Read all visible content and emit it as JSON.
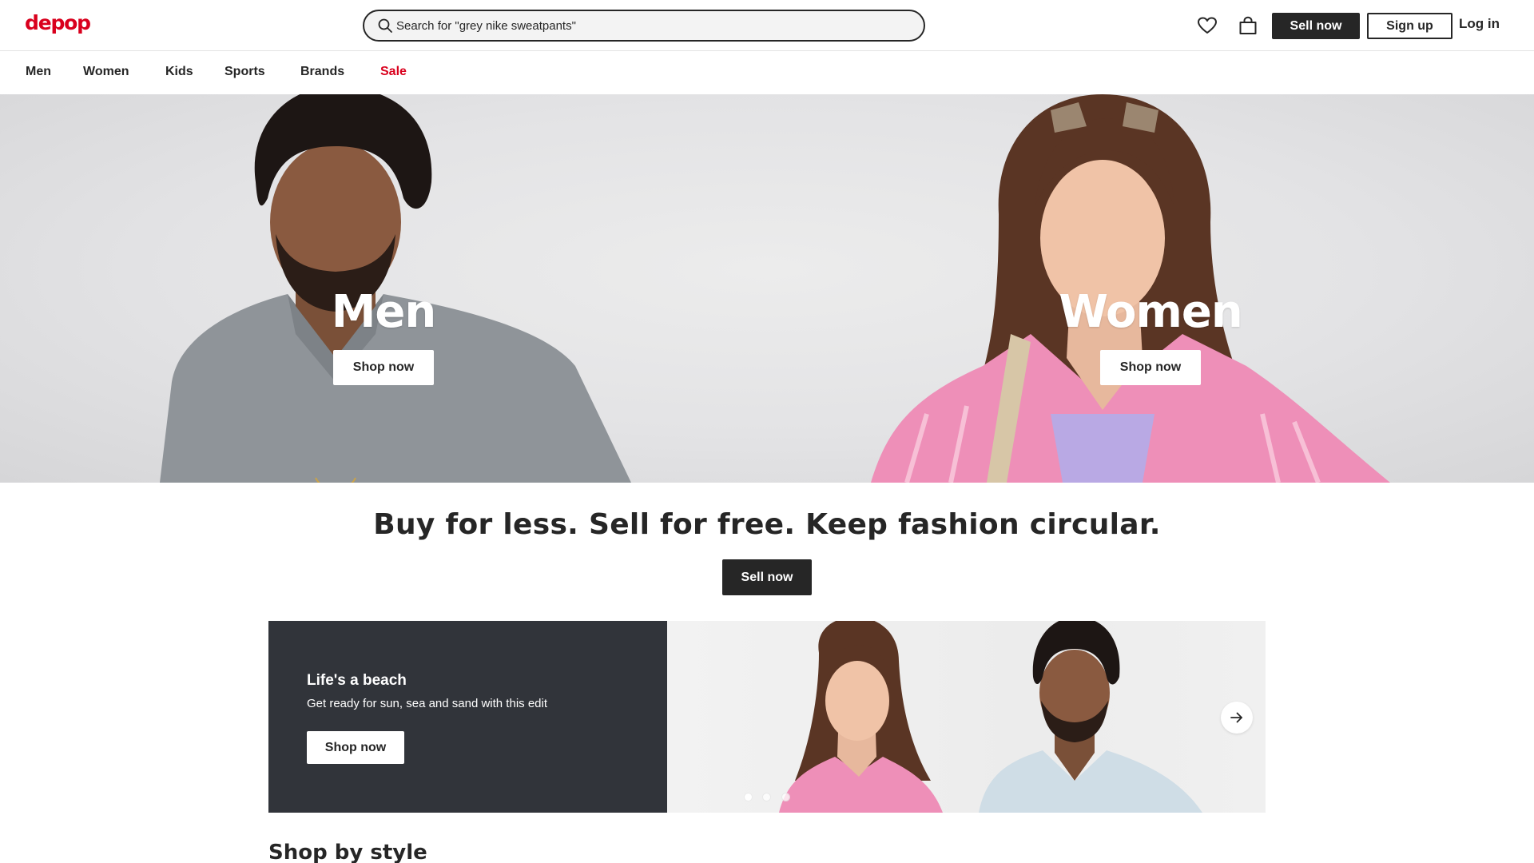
{
  "header": {
    "logo": "depop",
    "search": {
      "placeholder": "Search for \"grey nike sweatpants\""
    },
    "icons": [
      "heart-icon",
      "bag-icon",
      "search-icon"
    ],
    "sell_label": "Sell now",
    "signup_label": "Sign up",
    "login_label": "Log in"
  },
  "nav": {
    "items": [
      {
        "label": "Men"
      },
      {
        "label": "Women"
      },
      {
        "label": "Kids"
      },
      {
        "label": "Sports"
      },
      {
        "label": "Brands"
      },
      {
        "label": "Sale"
      }
    ]
  },
  "hero": {
    "panels": [
      {
        "title": "Men",
        "button": "Shop now"
      },
      {
        "title": "Women",
        "button": "Shop now"
      }
    ]
  },
  "tagline": {
    "text": "Buy for less. Sell for free. Keep fashion circular.",
    "button": "Sell now"
  },
  "promo": {
    "title": "Life's a beach",
    "subtitle": "Get ready for sun, sea and sand with this edit",
    "button": "Shop now",
    "icons": [
      "arrow-right-icon"
    ],
    "carousel": {
      "slides": 3,
      "active": 1
    }
  },
  "sections": {
    "shop_by_style": "Shop by style"
  },
  "colors": {
    "brand": "#d9001d",
    "dark": "#262626",
    "promo_bg": "#31343a",
    "hero_bg": "#e4e4e6",
    "pink_shirt": "#ee8fb8",
    "grey_shirt": "#8f9499"
  }
}
